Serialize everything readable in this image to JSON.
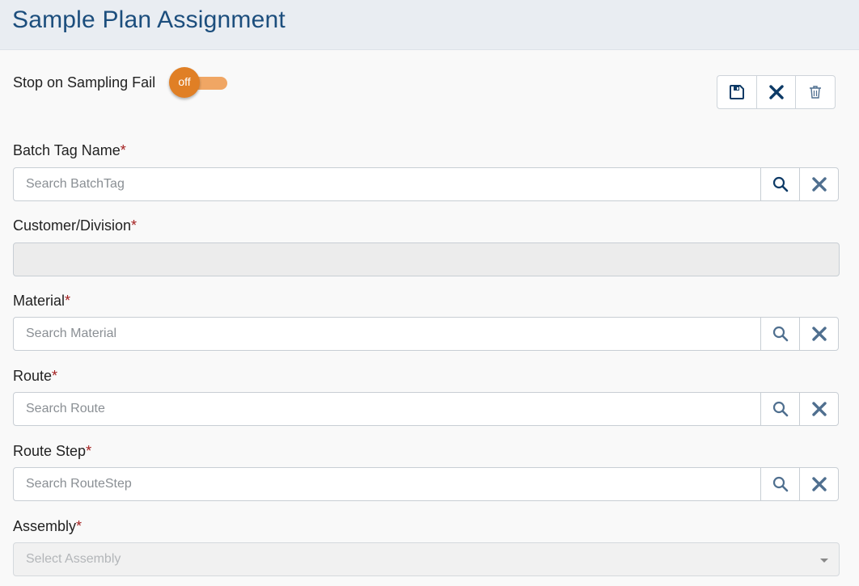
{
  "header": {
    "title": "Sample Plan Assignment"
  },
  "toggle": {
    "label": "Stop on Sampling Fail",
    "state": "off"
  },
  "actions": {
    "save_icon": "save-icon",
    "cancel_icon": "close-icon",
    "delete_icon": "trash-icon"
  },
  "fields": {
    "batch_tag": {
      "label": "Batch Tag Name",
      "required": "*",
      "placeholder": "Search BatchTag",
      "value": ""
    },
    "customer": {
      "label": "Customer/Division",
      "required": "*",
      "value": ""
    },
    "material": {
      "label": "Material",
      "required": "*",
      "placeholder": "Search Material",
      "value": ""
    },
    "route": {
      "label": "Route",
      "required": "*",
      "placeholder": "Search Route",
      "value": ""
    },
    "route_step": {
      "label": "Route Step",
      "required": "*",
      "placeholder": "Search RouteStep",
      "value": ""
    },
    "assembly": {
      "label": "Assembly",
      "required": "*",
      "placeholder": "Select Assembly"
    }
  },
  "colors": {
    "header_bg": "#e9edf2",
    "title": "#1c4e7d",
    "toggle_knob": "#e07f25",
    "toggle_track": "#f0a664",
    "required_star": "#a31f1f",
    "icon_dark": "#0d3a66",
    "icon_muted": "#4f6f8f"
  }
}
